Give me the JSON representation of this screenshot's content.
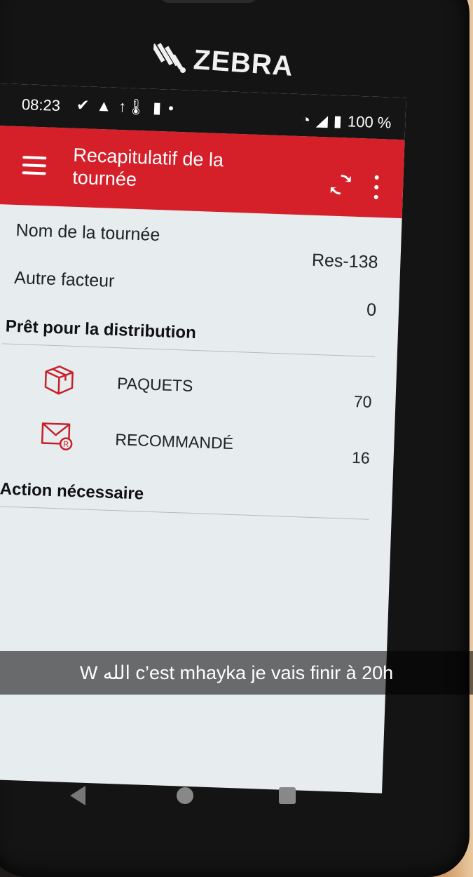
{
  "device": {
    "brand": "ZEBRA"
  },
  "status_bar": {
    "time": "08:23",
    "battery": "100 %"
  },
  "app_bar": {
    "title": "Recapitulatif de la tournée"
  },
  "summary": {
    "route_name_label": "Nom de la tournée",
    "route_name_value": "Res-138",
    "other_carrier_label": "Autre facteur",
    "other_carrier_value": "0"
  },
  "ready_section": {
    "title": "Prêt pour la distribution",
    "items": [
      {
        "label": "PAQUETS",
        "count": "70",
        "icon": "package-icon"
      },
      {
        "label": "RECOMMANDÉ",
        "count": "16",
        "icon": "registered-mail-icon"
      }
    ]
  },
  "action_section": {
    "title": "Action nécessaire"
  },
  "caption": {
    "text": "W الله c’est mhayka je vais finir à 20h"
  },
  "colors": {
    "accent": "#d5202a",
    "screen_bg": "#e7ecef"
  }
}
